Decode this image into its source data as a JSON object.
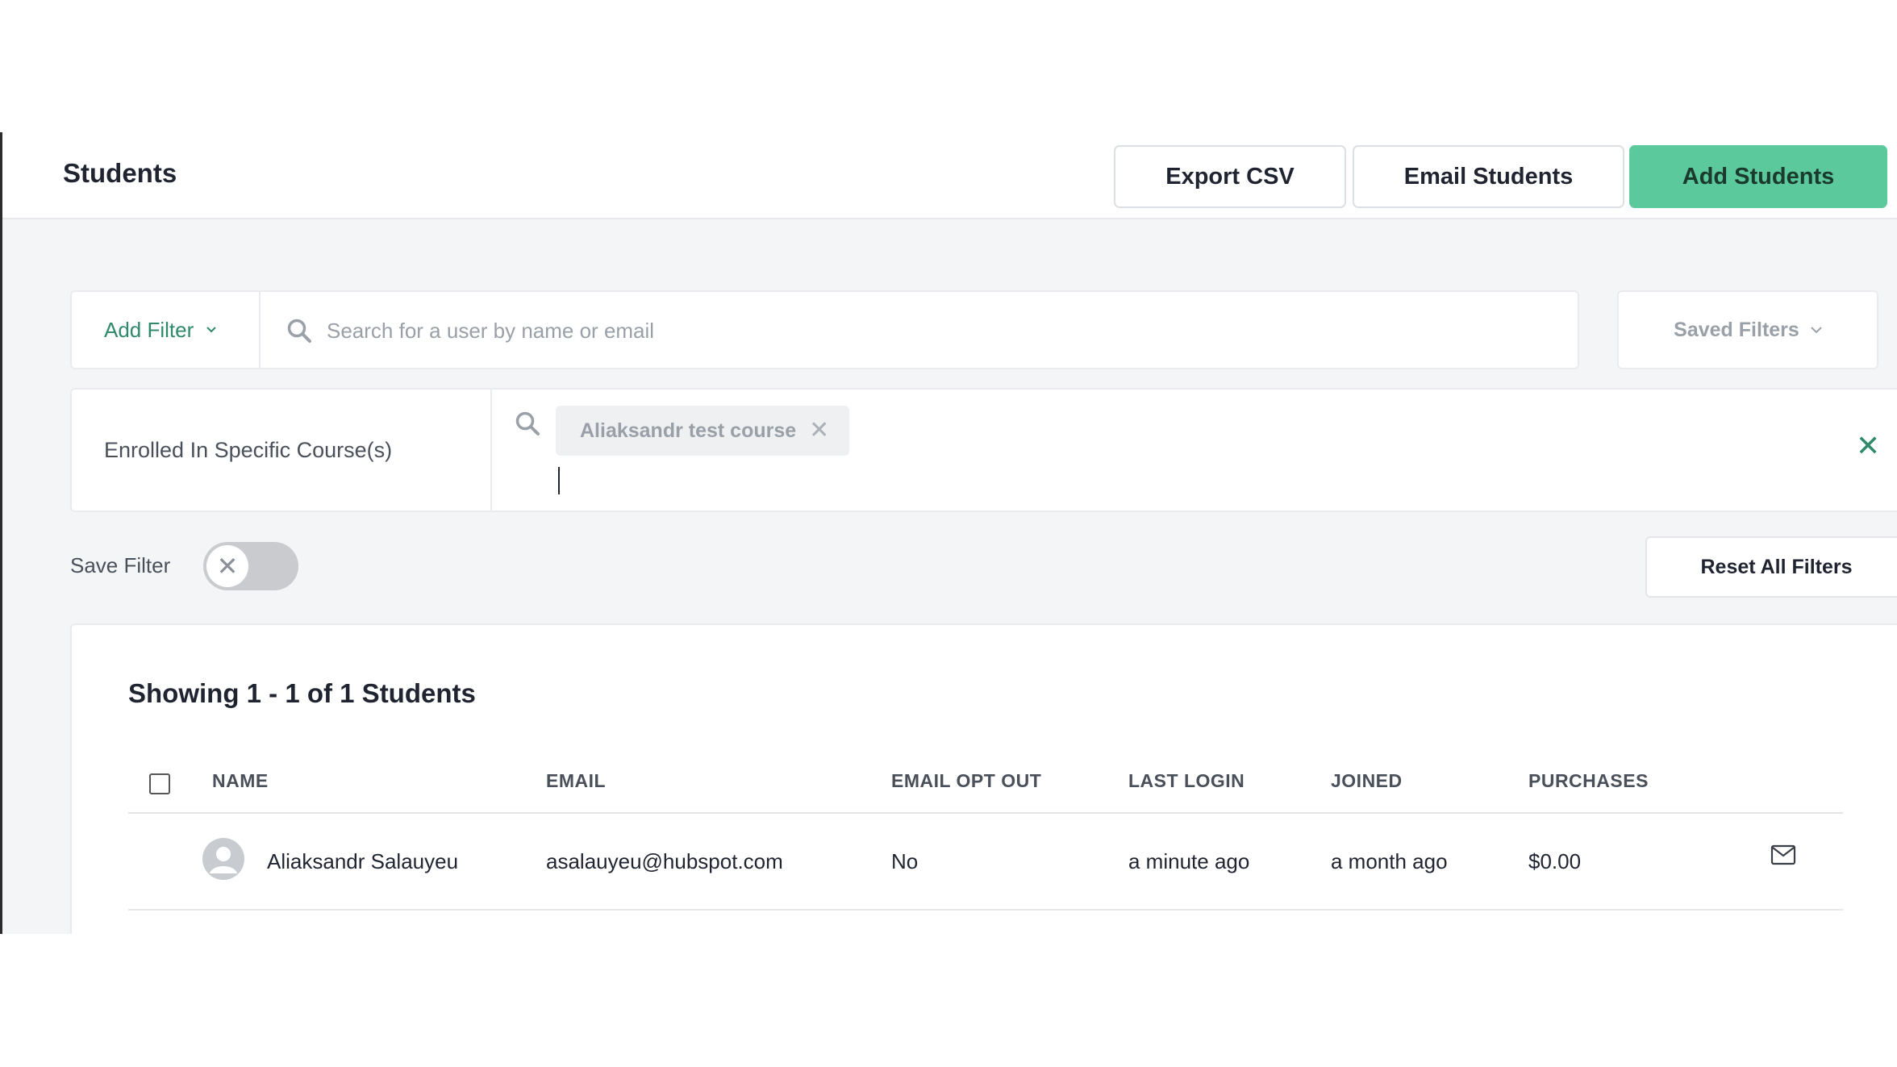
{
  "header": {
    "title": "Students",
    "export_label": "Export CSV",
    "email_label": "Email Students",
    "add_label": "Add Students"
  },
  "filters": {
    "add_filter_label": "Add Filter",
    "search_placeholder": "Search for a user by name or email",
    "saved_filters_label": "Saved Filters",
    "active_filter": {
      "label": "Enrolled In Specific Course(s)",
      "tags": [
        "Aliaksandr test course"
      ]
    },
    "save_filter_label": "Save Filter",
    "save_filter_enabled": false,
    "reset_label": "Reset All Filters"
  },
  "results": {
    "showing_text": "Showing 1 - 1 of 1 Students",
    "columns": [
      "NAME",
      "EMAIL",
      "EMAIL OPT OUT",
      "LAST LOGIN",
      "JOINED",
      "PURCHASES"
    ],
    "rows": [
      {
        "name": "Aliaksandr Salauyeu",
        "email": "asalauyeu@hubspot.com",
        "email_opt_out": "No",
        "last_login": "a minute ago",
        "joined": "a month ago",
        "purchases": "$0.00"
      }
    ]
  },
  "colors": {
    "accent": "#5bc99c",
    "link": "#2f8a69",
    "background": "#f4f5f7"
  },
  "icons": [
    "chevron-down-icon",
    "search-icon",
    "close-icon",
    "avatar-icon",
    "mail-icon"
  ]
}
